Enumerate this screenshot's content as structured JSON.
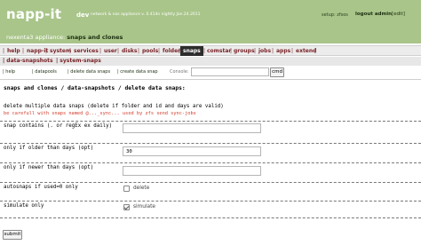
{
  "header": {
    "brand": "napp-it",
    "dev": "dev",
    "subtitle": "network & nas appliance v. 0.414n nightly Jan.24.2011",
    "setup": "setup: zfsos",
    "logout": "logout admin",
    "edit": "[edit]",
    "appliance_prefix": "nexenta3 appliance:",
    "appliance_section": "snaps and clones"
  },
  "menu": {
    "items": [
      "help",
      "napp-it",
      "system",
      "services",
      "user",
      "disks",
      "pools",
      "folder",
      "snaps",
      "comstar",
      "groups",
      "jobs",
      "apps",
      "extend"
    ],
    "active": "snaps"
  },
  "submenu": {
    "items": [
      "data-snapshots",
      "system-snaps"
    ]
  },
  "subsubmenu": {
    "items": [
      "help",
      "datapools",
      "delete data snaps",
      "create data snap"
    ],
    "console_label": "Console:",
    "console_value": "",
    "cmd_label": "cmd"
  },
  "page": {
    "title": "snaps and clones / data-snapshots / delete data snaps:",
    "description": "delete multiple data snaps (delete if folder and id and days are valid)",
    "warning": "be carefull with snaps named @..._sync... used by zfs send sync-jobs"
  },
  "form": {
    "fields": [
      {
        "label": "snap contains (. or regEx ex daily)",
        "value": ""
      },
      {
        "label": "only if older than days (opt)",
        "value": "30"
      },
      {
        "label": "only if newer than days (opt)",
        "value": ""
      }
    ],
    "checkboxes": [
      {
        "label": "autosnaps if used=0 only",
        "option": "delete",
        "checked": false
      },
      {
        "label": "simulate only",
        "option": "simulate",
        "checked": true
      }
    ],
    "submit_label": "submit"
  },
  "colors": {
    "header_bg": "#a9c58a",
    "menu_text": "#7a2328",
    "active_menu_bg": "#2c2c2c",
    "warning_text": "#d23a2a"
  }
}
